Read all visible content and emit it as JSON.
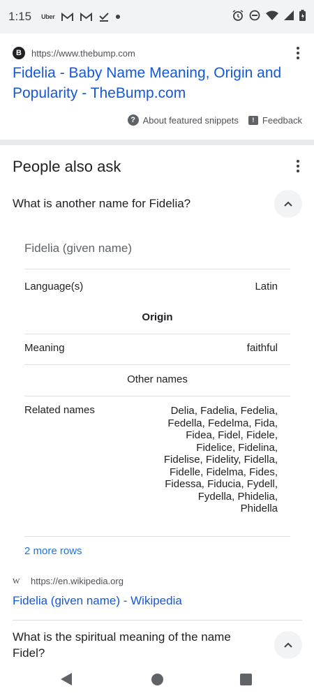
{
  "status_bar": {
    "time": "1:15",
    "notification_icons": [
      "uber-icon",
      "gmail-icon",
      "gmail-icon",
      "tasks-check-icon",
      "dot-icon"
    ],
    "uber_label": "Uber",
    "system_icons": [
      "alarm-icon",
      "do-not-disturb-icon",
      "wifi-icon",
      "signal-icon",
      "battery-icon"
    ]
  },
  "result1": {
    "favicon": "B",
    "url": "https://www.thebump.com",
    "title": "Fidelia - Baby Name Meaning, Origin and Popularity - TheBump.com",
    "about_snippets": "About featured snippets",
    "feedback": "Feedback"
  },
  "paa": {
    "title": "People also ask",
    "question1": "What is another name for Fidelia?",
    "knowledge": {
      "title": "Fidelia (given name)",
      "language_label": "Language(s)",
      "language_value": "Latin",
      "origin_header": "Origin",
      "meaning_label": "Meaning",
      "meaning_value": "faithful",
      "other_names_header": "Other names",
      "related_label": "Related names",
      "related_value": "Delia, Fadelia, Fedelia, Fedella, Fedelma, Fida, Fidea, Fidel, Fidele, Fidelice, Fidelina, Fidelise, Fidelity, Fidella, Fidelle, Fidelma, Fides, Fidessa, Fiducia, Fydell, Fydella, Phidelia, Phidella"
    },
    "more_rows": "2 more rows",
    "source": {
      "favicon": "W",
      "url": "https://en.wikipedia.org",
      "title": "Fidelia (given name) - Wikipedia"
    },
    "question2": "What is the spiritual meaning of the name Fidel?"
  },
  "nav_bar": {
    "buttons": [
      "back-icon",
      "home-icon",
      "recents-icon"
    ]
  }
}
